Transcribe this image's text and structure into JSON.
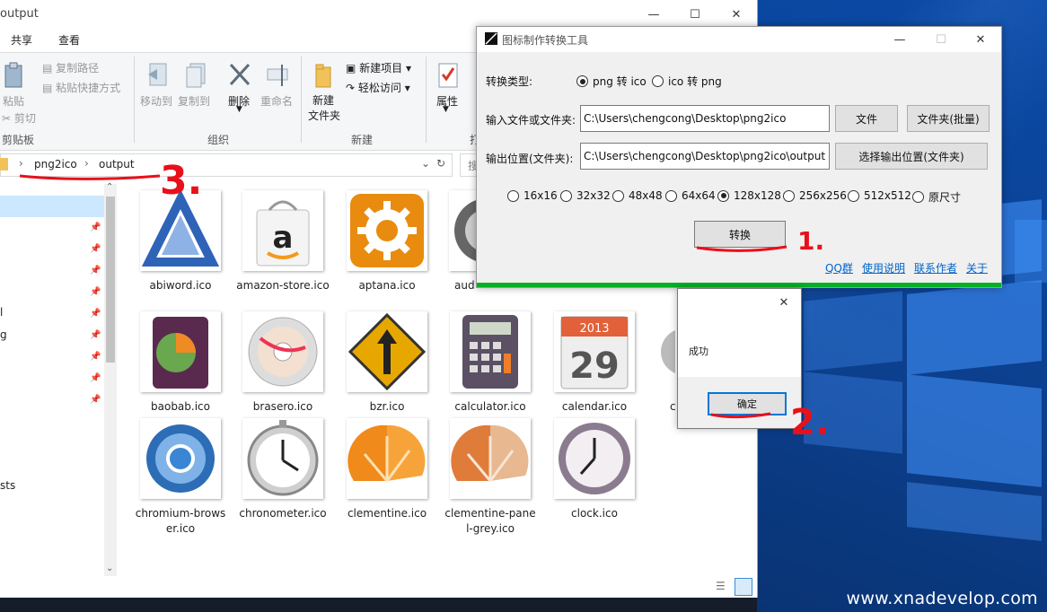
{
  "explorer": {
    "title": "output",
    "tabs": [
      "共享",
      "查看"
    ],
    "clipboard": {
      "paste": "粘贴",
      "copy_path": "复制路径",
      "paste_shortcut": "粘贴快捷方式",
      "cut": "剪切",
      "group": "剪贴板"
    },
    "organize": {
      "move_to": "移动到",
      "copy_to": "复制到",
      "delete": "删除",
      "rename": "重命名",
      "group": "组织"
    },
    "new": {
      "new_folder_line1": "新建",
      "new_folder_line2": "文件夹",
      "new_item": "新建项目",
      "easy_access": "轻松访问",
      "group": "新建"
    },
    "open": {
      "properties": "属性",
      "group": "打"
    },
    "breadcrumb": [
      "png2ico",
      "output"
    ],
    "search_placeholder": "搜",
    "nav_items": [
      "l",
      "g",
      "sts"
    ],
    "files": [
      {
        "name": "abiword.ico"
      },
      {
        "name": "amazon-store.ico"
      },
      {
        "name": "aptana.ico"
      },
      {
        "name": "aud"
      },
      {
        "name": "baobab.ico"
      },
      {
        "name": "brasero.ico"
      },
      {
        "name": "bzr.ico"
      },
      {
        "name": "calculator.ico"
      },
      {
        "name": "calendar.ico"
      },
      {
        "name": "c"
      },
      {
        "name": "chromium-browser.ico"
      },
      {
        "name": "chronometer.ico"
      },
      {
        "name": "clementine.ico"
      },
      {
        "name": "clementine-panel-grey.ico"
      },
      {
        "name": "clock.ico"
      }
    ],
    "calendar_year": "2013",
    "calendar_day": "29"
  },
  "tool": {
    "title": "图标制作转换工具",
    "convert_type_label": "转换类型:",
    "type_options": [
      {
        "label": "png 转 ico",
        "selected": true
      },
      {
        "label": "ico 转 png",
        "selected": false
      }
    ],
    "input_label": "输入文件或文件夹:",
    "input_value": "C:\\Users\\chengcong\\Desktop\\png2ico",
    "file_button": "文件",
    "folder_batch_button": "文件夹(批量)",
    "output_label": "输出位置(文件夹):",
    "output_value": "C:\\Users\\chengcong\\Desktop\\png2ico\\output",
    "choose_output_button": "选择输出位置(文件夹)",
    "sizes": [
      {
        "label": "16x16",
        "selected": false
      },
      {
        "label": "32x32",
        "selected": false
      },
      {
        "label": "48x48",
        "selected": false
      },
      {
        "label": "64x64",
        "selected": false
      },
      {
        "label": "128x128",
        "selected": true
      },
      {
        "label": "256x256",
        "selected": false
      },
      {
        "label": "512x512",
        "selected": false
      },
      {
        "label": "原尺寸",
        "selected": false
      }
    ],
    "convert_button": "转换",
    "links": [
      "QQ群",
      "使用说明",
      "联系作者",
      "关于"
    ]
  },
  "dialog": {
    "message": "成功",
    "ok_button": "确定"
  },
  "annotations": [
    "1.",
    "2.",
    "3."
  ],
  "watermark": "www.xnadevelop.com",
  "colors": {
    "link": "#0066cc",
    "progress": "#06b025",
    "annotation": "#e8101a"
  }
}
